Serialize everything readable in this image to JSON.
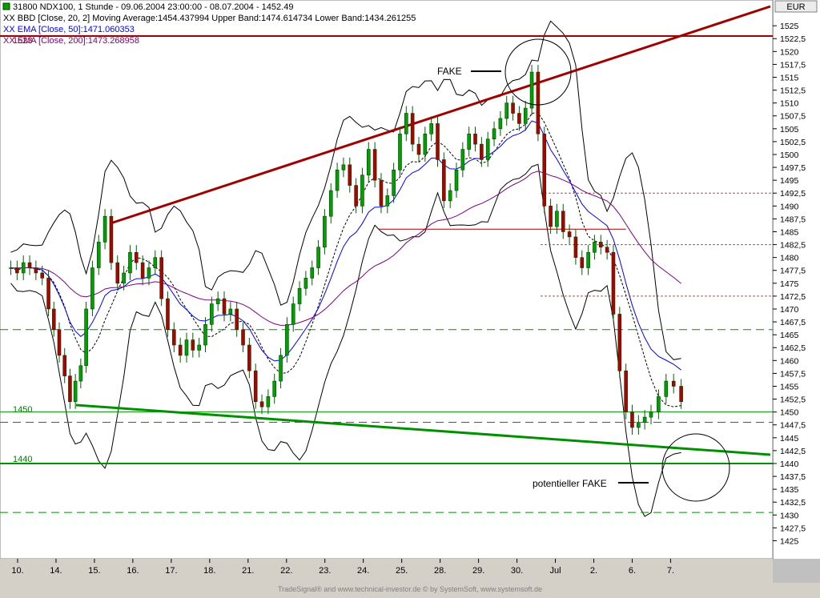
{
  "header": {
    "line1": "31800  NDX100, 1 Stunde - 09.06.2004 23:00:00 - 08.07.2004 - 1452.49",
    "line2": "XX BBD [Close, 20, 2] Moving Average:1454.437994 Upper Band:1474.614734 Lower Band:1434.261255",
    "line3": "XX EMA [Close, 50]:1471.060353",
    "line4": "XX EMA [Close, 200]:1473.268958"
  },
  "currency_label": "EUR",
  "footer": "TradeSignal® and www.technical-investor.de © by  SystemSoft, www.systemsoft.de",
  "annotations": {
    "fake": "FAKE",
    "potential_fake": "potentieller FAKE",
    "level_1450": "1450",
    "level_1440": "1440",
    "level_1523": "1523"
  },
  "colors": {
    "background": "#c0c0c0",
    "plot_bg": "#ffffff",
    "candle": "#008000",
    "resistance_trend": "#a00000",
    "support_trend": "#009000",
    "ema50": "#0000ff",
    "ema200": "#800080",
    "bollinger": "#000000"
  },
  "chart_data": {
    "type": "candlestick",
    "ylim": [
      1421.5,
      1530
    ],
    "yticks": [
      1525,
      1522.5,
      1520,
      1517.5,
      1515,
      1512.5,
      1510,
      1507.5,
      1505,
      1502.5,
      1500,
      1497.5,
      1495,
      1492.5,
      1490,
      1487.5,
      1485,
      1482.5,
      1480,
      1477.5,
      1475,
      1472.5,
      1470,
      1467.5,
      1465,
      1462.5,
      1460,
      1457.5,
      1455,
      1452.5,
      1450,
      1447.5,
      1445,
      1442.5,
      1440,
      1437.5,
      1435,
      1432.5,
      1430,
      1427.5,
      1425
    ],
    "ytick_labels": [
      "1525",
      "1522,5",
      "1520",
      "1517,5",
      "1515",
      "1512,5",
      "1510",
      "1507,5",
      "1505",
      "1502,5",
      "1500",
      "1497,5",
      "1495",
      "1492,5",
      "1490",
      "1487,5",
      "1485",
      "1482,5",
      "1480",
      "1477,5",
      "1475",
      "1472,5",
      "1470",
      "1467,5",
      "1465",
      "1462,5",
      "1460",
      "1457,5",
      "1455",
      "1452,5",
      "1450",
      "1447,5",
      "1445",
      "1442,5",
      "1440",
      "1437,5",
      "1435",
      "1432,5",
      "1430",
      "1427,5",
      "1425"
    ],
    "xlabels": [
      "10.",
      "14.",
      "15.",
      "16.",
      "17.",
      "18.",
      "21.",
      "22.",
      "23.",
      "24.",
      "25.",
      "28.",
      "29.",
      "30.",
      "Jul",
      "2.",
      "6.",
      "7."
    ],
    "xlabel_positions": [
      0.5,
      2.5,
      4.5,
      6.5,
      8.5,
      10.5,
      12.5,
      14.5,
      16.5,
      18.5,
      20.5,
      22.5,
      24.5,
      26.5,
      28.5,
      30.5,
      32.5,
      34.5
    ],
    "slots_total": 37,
    "close_series": [
      {
        "day": "10.",
        "x_start": 0,
        "closes": [
          1478,
          1477,
          1479,
          1478,
          1477,
          1476
        ]
      },
      {
        "day": "14.",
        "x_start": 2,
        "closes": [
          1470,
          1466,
          1461,
          1457,
          1452,
          1456,
          1459
        ]
      },
      {
        "day": "15.",
        "x_start": 4,
        "closes": [
          1470,
          1478,
          1483,
          1488,
          1479,
          1475
        ]
      },
      {
        "day": "16.",
        "x_start": 6,
        "closes": [
          1477,
          1481,
          1479,
          1476,
          1478,
          1480
        ]
      },
      {
        "day": "17.",
        "x_start": 8,
        "closes": [
          1472,
          1466,
          1463,
          1461,
          1464,
          1462
        ]
      },
      {
        "day": "18.",
        "x_start": 10,
        "closes": [
          1463,
          1467,
          1471,
          1472,
          1469,
          1470
        ]
      },
      {
        "day": "21.",
        "x_start": 12,
        "closes": [
          1466,
          1463,
          1458,
          1452,
          1451,
          1453
        ]
      },
      {
        "day": "22.",
        "x_start": 14,
        "closes": [
          1456,
          1461,
          1467,
          1471,
          1474,
          1476
        ]
      },
      {
        "day": "23.",
        "x_start": 16,
        "closes": [
          1478,
          1482,
          1488,
          1493,
          1497,
          1498
        ]
      },
      {
        "day": "24.",
        "x_start": 18,
        "closes": [
          1494,
          1490,
          1496,
          1501,
          1495,
          1490
        ]
      },
      {
        "day": "25.",
        "x_start": 20,
        "closes": [
          1492,
          1497,
          1504,
          1508,
          1502,
          1500
        ]
      },
      {
        "day": "28.",
        "x_start": 22,
        "closes": [
          1504,
          1506,
          1499,
          1491,
          1493,
          1497
        ]
      },
      {
        "day": "29.",
        "x_start": 24,
        "closes": [
          1501,
          1504,
          1502,
          1499,
          1503,
          1505
        ]
      },
      {
        "day": "30.",
        "x_start": 26,
        "closes": [
          1507,
          1510,
          1508,
          1506,
          1509,
          1516
        ]
      },
      {
        "day": "Jul",
        "x_start": 28,
        "closes": [
          1504,
          1490,
          1486,
          1489,
          1485,
          1484
        ]
      },
      {
        "day": "2.",
        "x_start": 30,
        "closes": [
          1480,
          1478,
          1481,
          1483,
          1482,
          1481
        ]
      },
      {
        "day": "6.",
        "x_start": 32,
        "closes": [
          1469,
          1458,
          1450,
          1447,
          1448,
          1449
        ]
      },
      {
        "day": "7.",
        "x_start": 34,
        "closes": [
          1450,
          1453,
          1456,
          1455,
          1452
        ]
      }
    ],
    "horizontal_levels": [
      {
        "value": 1523,
        "style": "solid",
        "color": "#a00000"
      },
      {
        "value": 1492.5,
        "style": "dotted",
        "color": "#a00000",
        "x_from": 0.7
      },
      {
        "value": 1485.5,
        "style": "solid",
        "color": "#a00000",
        "x_from": 0.49,
        "x_to": 0.81
      },
      {
        "value": 1482.5,
        "style": "dotted",
        "color": "#a00000",
        "x_from": 0.7
      },
      {
        "value": 1472.5,
        "style": "dotted",
        "color": "#a00000",
        "x_from": 0.7
      },
      {
        "value": 1466,
        "style": "dashed",
        "color": "#009000"
      },
      {
        "value": 1450,
        "style": "solid",
        "color": "#009000"
      },
      {
        "value": 1448,
        "style": "dashed",
        "color": "#009000"
      },
      {
        "value": 1440,
        "style": "solid",
        "color": "#009000"
      },
      {
        "value": 1430.5,
        "style": "dashed",
        "color": "#009000"
      }
    ]
  }
}
